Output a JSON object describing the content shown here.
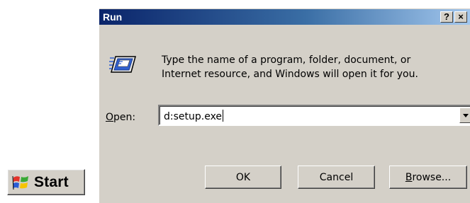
{
  "taskbar": {
    "start_label": "Start",
    "start_icon": "windows-flag-icon"
  },
  "dialog": {
    "title": "Run",
    "help_glyph": "?",
    "close_glyph": "×",
    "icon": "run-icon",
    "description_line1": "Type the name of a program, folder, document, or",
    "description_line2": "Internet resource, and Windows will open it for you.",
    "open_label_mnemonic": "O",
    "open_label_rest": "pen:",
    "open_value": "d:setup.exe",
    "ok_label": "OK",
    "cancel_label": "Cancel",
    "browse_mnemonic": "B",
    "browse_rest": "rowse...",
    "colors": {
      "titlebar_start": "#0a246a",
      "titlebar_end": "#a6caf0",
      "face": "#d4d0c8"
    }
  }
}
